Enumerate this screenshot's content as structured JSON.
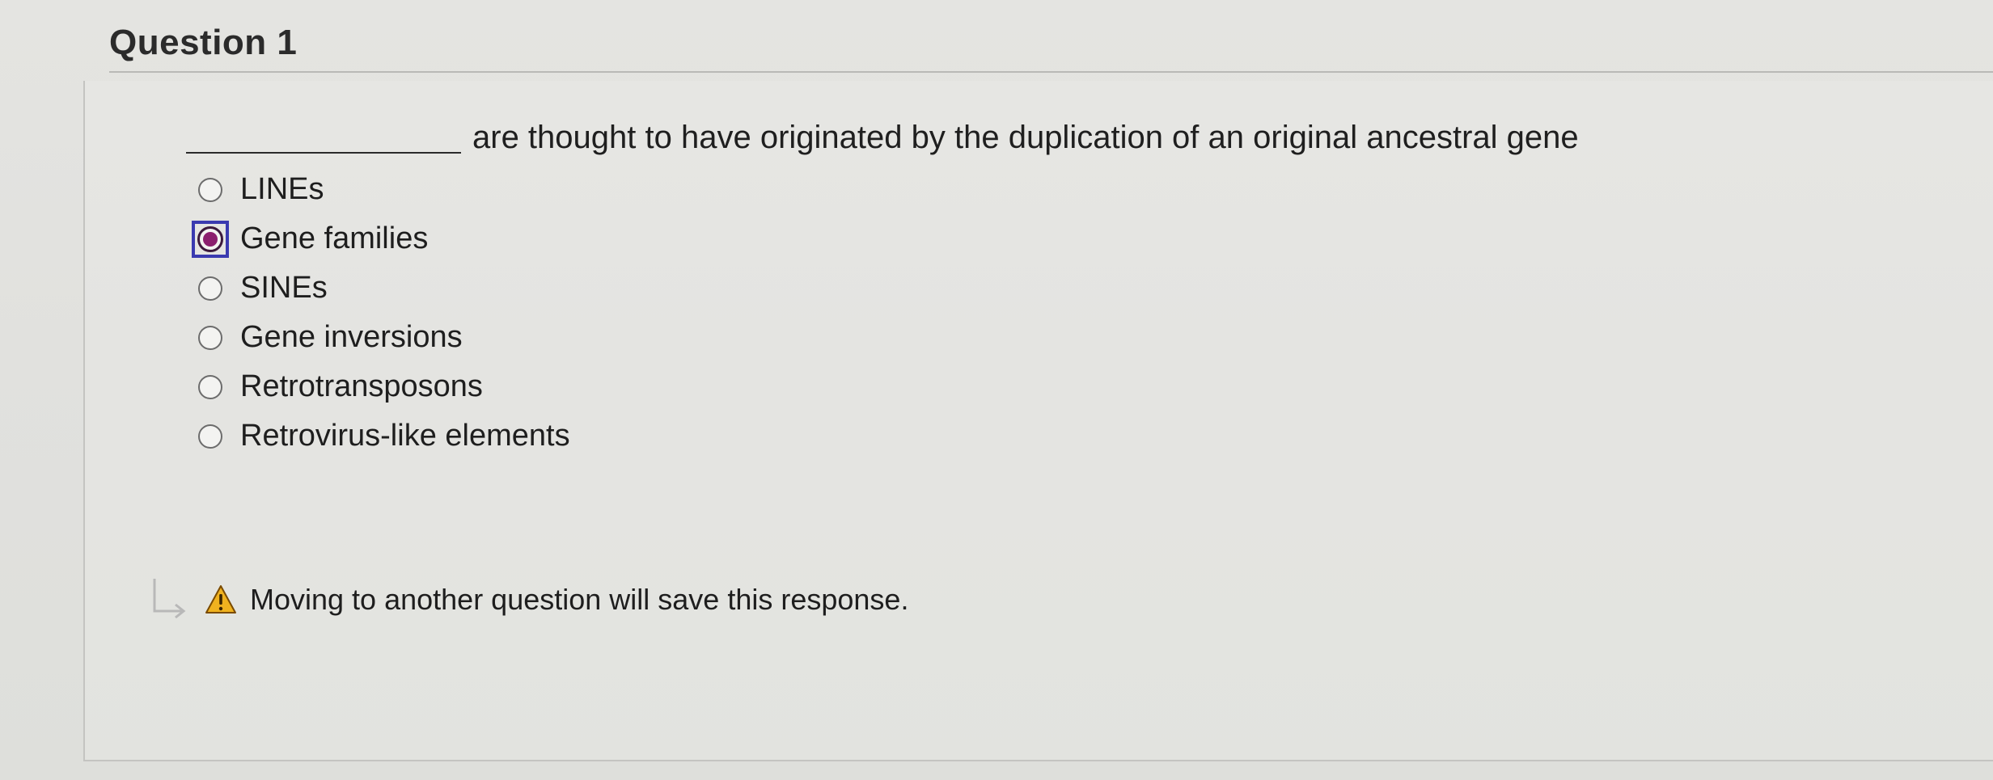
{
  "question": {
    "title": "Question 1",
    "prompt": "are thought to have originated by the duplication of an original ancestral gene"
  },
  "options": [
    {
      "label": "LINEs",
      "selected": false
    },
    {
      "label": "Gene families",
      "selected": true
    },
    {
      "label": "SINEs",
      "selected": false
    },
    {
      "label": "Gene inversions",
      "selected": false
    },
    {
      "label": "Retrotransposons",
      "selected": false
    },
    {
      "label": "Retrovirus-like elements",
      "selected": false
    }
  ],
  "notice": {
    "text": "Moving to another question will save this response.",
    "icon": "warning-icon"
  },
  "colors": {
    "selected_dot": "#8b1e6e",
    "focus_ring": "#3a3ab0",
    "warning": "#e8a317"
  }
}
